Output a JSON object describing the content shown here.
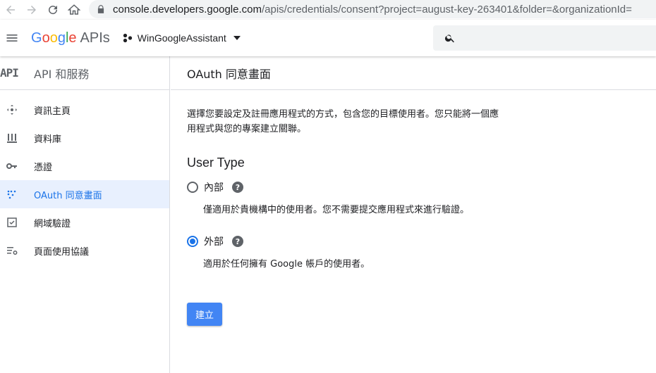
{
  "browser": {
    "url_host": "console.developers.google.com",
    "url_path": "/apis/credentials/consent?project=august-key-263401&folder=&organizationId="
  },
  "header": {
    "logo_letters": [
      "G",
      "o",
      "o",
      "g",
      "l",
      "e"
    ],
    "logo_suffix": "APIs",
    "project_name": "WinGoogleAssistant"
  },
  "sidebar": {
    "mark": "API",
    "title": "API 和服務",
    "items": [
      {
        "label": "資訊主頁",
        "icon": "dashboard-icon"
      },
      {
        "label": "資料庫",
        "icon": "library-icon"
      },
      {
        "label": "憑證",
        "icon": "key-icon"
      },
      {
        "label": "OAuth 同意畫面",
        "icon": "consent-icon"
      },
      {
        "label": "網域驗證",
        "icon": "checkbox-icon"
      },
      {
        "label": "頁面使用協議",
        "icon": "settings-list-icon"
      }
    ],
    "active_index": 3
  },
  "main": {
    "title": "OAuth 同意畫面",
    "intro_line1": "選擇您要設定及註冊應用程式的方式，包含您的目標使用者。您只能將一個應",
    "intro_line2": "用程式與您的專案建立關聯。",
    "section_title": "User Type",
    "options": [
      {
        "label": "內部",
        "description": "僅適用於貴機構中的使用者。您不需要提交應用程式來進行驗證。",
        "selected": false
      },
      {
        "label": "外部",
        "description": "適用於任何擁有 Google 帳戶的使用者。",
        "selected": true
      }
    ],
    "help_glyph": "?",
    "create_label": "建立"
  },
  "colors": {
    "accent": "#1a73e8",
    "button": "#4285f4",
    "active_bg": "#e8f0fe"
  }
}
